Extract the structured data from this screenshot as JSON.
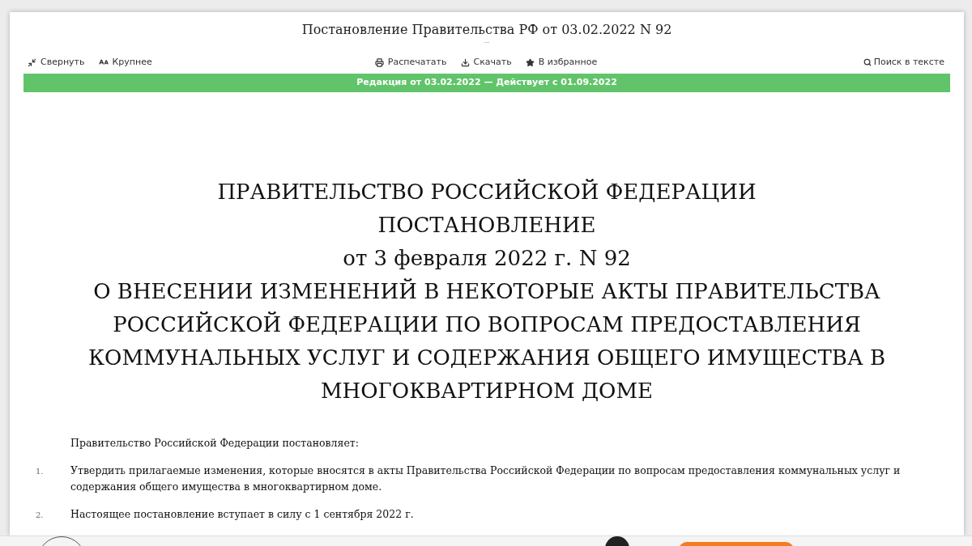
{
  "document_title": "Постановление Правительства РФ от 03.02.2022 N 92",
  "title_more": "...",
  "toolbar_left": [
    {
      "kind": "collapse",
      "label": "Свернуть"
    },
    {
      "kind": "font",
      "label": "Крупнее"
    }
  ],
  "toolbar_center": [
    {
      "kind": "print",
      "label": "Распечатать"
    },
    {
      "kind": "download",
      "label": "Скачать"
    },
    {
      "kind": "favorite",
      "label": "В избранное"
    }
  ],
  "search": {
    "label": "Поиск в тексте"
  },
  "edition_banner": "Редакция от 03.02.2022 — Действует с 01.09.2022",
  "heading_lines": [
    "ПРАВИТЕЛЬСТВО РОССИЙСКОЙ ФЕДЕРАЦИИ",
    "ПОСТАНОВЛЕНИЕ",
    "от 3 февраля 2022 г. N 92",
    "О ВНЕСЕНИИ ИЗМЕНЕНИЙ В НЕКОТОРЫЕ АКТЫ ПРАВИТЕЛЬСТВА",
    "РОССИЙСКОЙ ФЕДЕРАЦИИ ПО ВОПРОСАМ ПРЕДОСТАВЛЕНИЯ",
    "КОММУНАЛЬНЫХ УСЛУГ И СОДЕРЖАНИЯ ОБЩЕГО ИМУЩЕСТВА В",
    "МНОГОКВАРТИРНОМ ДОМЕ"
  ],
  "intro": "Правительство Российской Федерации постановляет:",
  "items": [
    {
      "number": "1.",
      "text": "Утвердить прилагаемые изменения, которые вносятся в акты Правительства Российской Федерации по вопросам предоставления коммунальных услуг и содержания общего имущества в многоквартирном доме."
    },
    {
      "number": "2.",
      "text": "Настоящее постановление вступает в силу с 1 сентября 2022 г."
    }
  ]
}
